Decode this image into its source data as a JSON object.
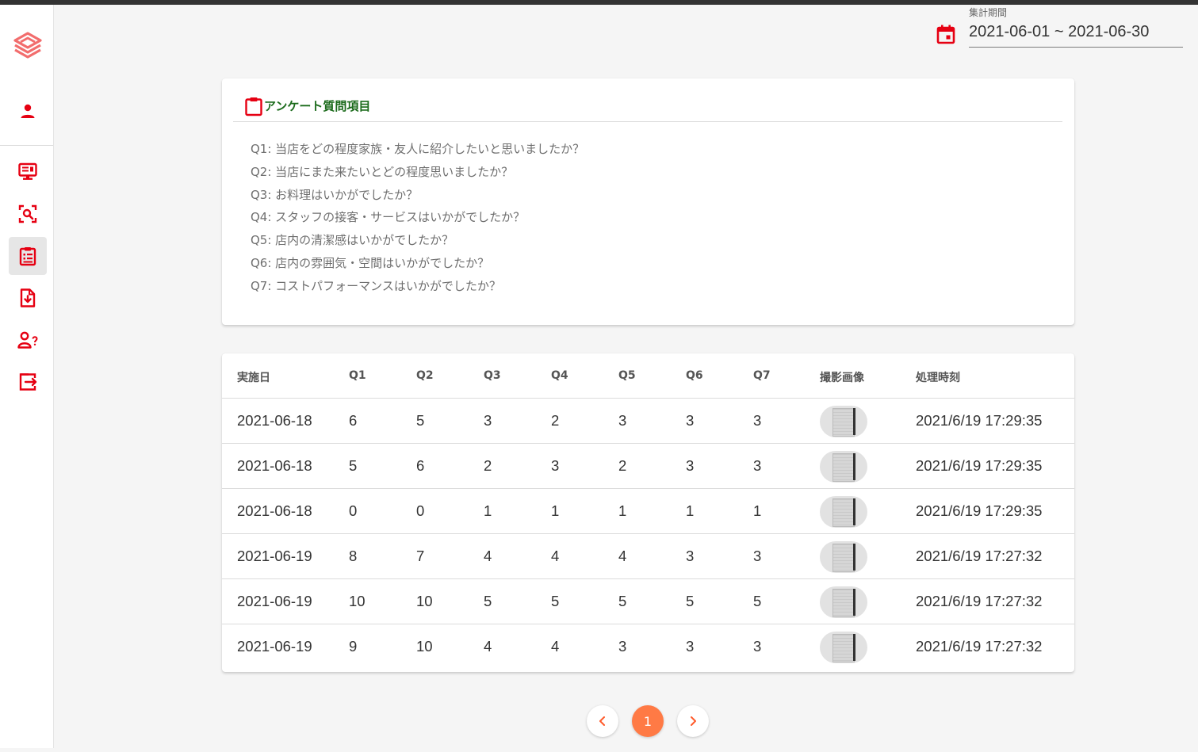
{
  "period": {
    "label": "集計期間",
    "value": "2021-06-01 ~ 2021-06-30"
  },
  "questions_card": {
    "title": "アンケート質問項目",
    "items": [
      "Q1: 当店をどの程度家族・友人に紹介したいと思いましたか？",
      "Q2: 当店にまた来たいとどの程度思いましたか？",
      "Q3: お料理はいかがでしたか？",
      "Q4: スタッフの接客・サービスはいかがでしたか？",
      "Q5: 店内の清潔感はいかがでしたか？",
      "Q6: 店内の雰囲気・空間はいかがでしたか？",
      "Q7: コストパフォーマンスはいかがでしたか？"
    ]
  },
  "table": {
    "headers": [
      "実施日",
      "Q1",
      "Q2",
      "Q3",
      "Q4",
      "Q5",
      "Q6",
      "Q7",
      "撮影画像",
      "処理時刻"
    ],
    "rows": [
      [
        "2021-06-18",
        "6",
        "5",
        "3",
        "2",
        "3",
        "3",
        "3",
        "2021/6/19 17:29:35"
      ],
      [
        "2021-06-18",
        "5",
        "6",
        "2",
        "3",
        "2",
        "3",
        "3",
        "2021/6/19 17:29:35"
      ],
      [
        "2021-06-18",
        "0",
        "0",
        "1",
        "1",
        "1",
        "1",
        "1",
        "2021/6/19 17:29:35"
      ],
      [
        "2021-06-19",
        "8",
        "7",
        "4",
        "4",
        "4",
        "3",
        "3",
        "2021/6/19 17:27:32"
      ],
      [
        "2021-06-19",
        "10",
        "10",
        "5",
        "5",
        "5",
        "5",
        "5",
        "2021/6/19 17:27:32"
      ],
      [
        "2021-06-19",
        "9",
        "10",
        "4",
        "4",
        "3",
        "3",
        "3",
        "2021/6/19 17:27:32"
      ]
    ]
  },
  "pagination": {
    "current": "1"
  },
  "sidebar": {
    "icons": [
      "logo-icon",
      "user-icon",
      "monitor-icon",
      "scan-search-icon",
      "clipboard-list-icon",
      "file-download-icon",
      "user-question-icon",
      "logout-icon"
    ],
    "active": "clipboard-list-icon"
  },
  "colors": {
    "accent_red": "#e60012",
    "title_green": "#1a6a1a",
    "pager_active": "#ff7a45"
  }
}
